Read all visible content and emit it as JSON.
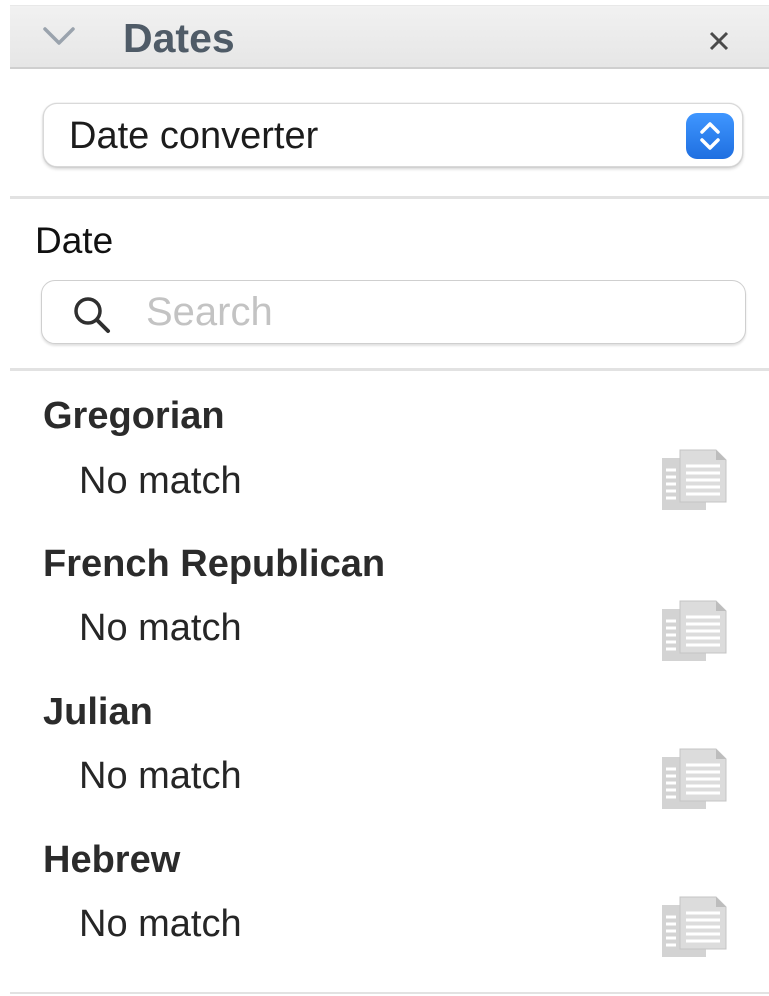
{
  "header": {
    "title": "Dates",
    "collapse_icon": "chevron-down-icon",
    "close_icon": "close-icon"
  },
  "converter": {
    "selected": "Date converter",
    "stepper_icon": "up-down-arrows-icon",
    "accent_color": "#2a7ff0"
  },
  "date_label": "Date",
  "search": {
    "placeholder": "Search",
    "value": "",
    "icon": "search-icon"
  },
  "calendars": [
    {
      "name": "Gregorian",
      "value": "No match",
      "copy_icon": "copy-icon"
    },
    {
      "name": "French Republican",
      "value": "No match",
      "copy_icon": "copy-icon"
    },
    {
      "name": "Julian",
      "value": "No match",
      "copy_icon": "copy-icon"
    },
    {
      "name": "Hebrew",
      "value": "No match",
      "copy_icon": "copy-icon"
    }
  ]
}
